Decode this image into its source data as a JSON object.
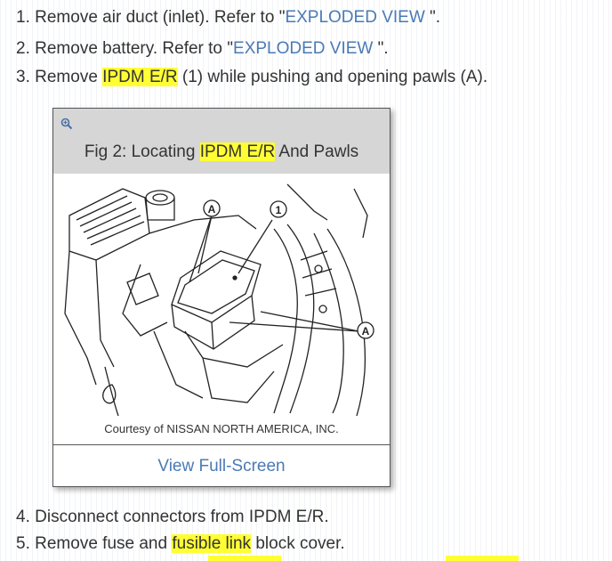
{
  "steps": [
    {
      "num": "1.",
      "pre": "Remove air duct (inlet). Refer to ",
      "link": "EXPLODED VIEW",
      "post": "\"."
    },
    {
      "num": "2.",
      "pre": "Remove battery. Refer to ",
      "link": "EXPLODED VIEW",
      "post": "\"."
    },
    {
      "num": "3.",
      "pre": "Remove ",
      "hl": "IPDM E/R",
      "post": " (1) while pushing and opening pawls (A)."
    },
    {
      "num": "4.",
      "text": "Disconnect connectors from IPDM E/R."
    },
    {
      "num": "5.",
      "pre": "Remove fuse and ",
      "hl": "fusible link",
      "post": " block cover."
    }
  ],
  "figure": {
    "title_pre": "Fig 2: Locating ",
    "title_hl": "IPDM E/R",
    "title_post": " And Pawls",
    "credit": "Courtesy of NISSAN NORTH AMERICA, INC.",
    "view_link": "View Full-Screen",
    "zoom_icon": "zoom-in-icon",
    "callouts": {
      "one": "1",
      "a": "A"
    }
  },
  "colors": {
    "link": "#4a7ab5",
    "highlight": "#ffff33",
    "figure_header": "#d6d6d6"
  }
}
